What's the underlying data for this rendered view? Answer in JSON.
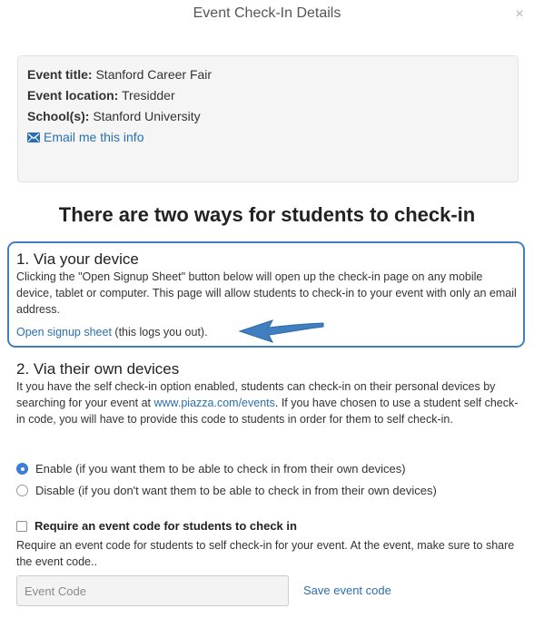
{
  "modal": {
    "title": "Event Check-In Details",
    "close_label": "×"
  },
  "info": {
    "event_title_label": "Event title:",
    "event_title_value": "Stanford Career Fair",
    "event_location_label": "Event location:",
    "event_location_value": "Tresidder",
    "schools_label": "School(s):",
    "schools_value": "Stanford University",
    "email_link": "Email me this info",
    "email_icon": "envelope-icon"
  },
  "main_heading": "There are two ways for students to check-in",
  "section1": {
    "title": "1. Via your device",
    "description": "Clicking the \"Open Signup Sheet\" button below will open up the check-in page on any mobile device, tablet or computer. This page will allow students to check-in to your event with only an email address.",
    "link_text": "Open signup sheet",
    "link_suffix": " (this logs you out).",
    "arrow_icon": "arrow-left-icon"
  },
  "section2": {
    "title": "2. Via their own devices",
    "description_part1": "It you have the self check-in option enabled, students can check-in on their personal devices by searching for your event at ",
    "url_text": "www.piazza.com/events",
    "description_part2": ". If you have chosen to use a student self check-in code, you will have to provide this code to students in order for them to self check-in.",
    "options": [
      {
        "label": "Enable (if you want them to be able to check in from their own devices)",
        "selected": true
      },
      {
        "label": "Disable (if you don't want them to be able to check in from their own devices)",
        "selected": false
      }
    ]
  },
  "event_code": {
    "checkbox_label": "Require an event code for students to check in",
    "checked": false,
    "description": "Require an event code for students to self check-in for your event. At the event, make sure to share the event code..",
    "input_placeholder": "Event Code",
    "input_value": "",
    "save_label": "Save event code"
  },
  "colors": {
    "accent": "#2a6fb0",
    "highlight_border": "#3f7fc0",
    "radio_selected": "#3b7dd8"
  }
}
